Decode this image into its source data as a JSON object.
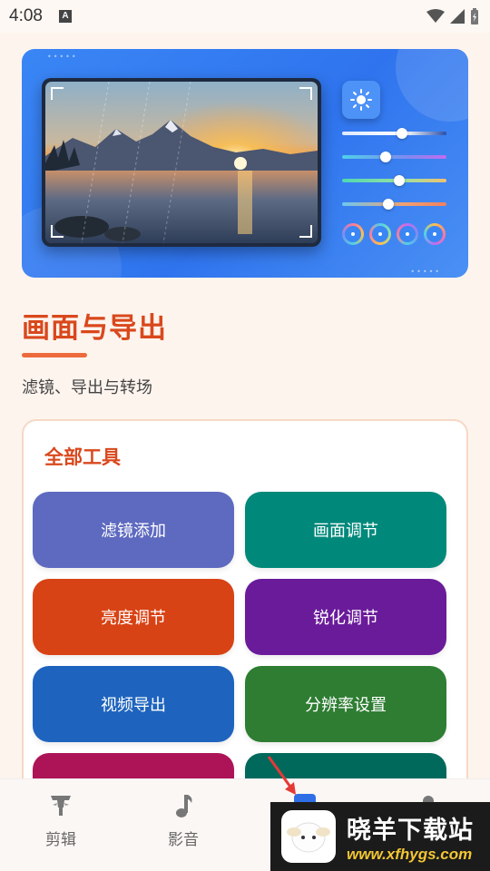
{
  "status_bar": {
    "time": "4:08",
    "notification_icon": "A"
  },
  "hero": {
    "sun_icon": "sun-icon"
  },
  "section": {
    "title": "画面与导出",
    "subtitle": "滤镜、导出与转场"
  },
  "tools": {
    "title": "全部工具",
    "items": [
      {
        "label": "滤镜添加",
        "color": "#5e6ac0"
      },
      {
        "label": "画面调节",
        "color": "#00897b"
      },
      {
        "label": "亮度调节",
        "color": "#d84315"
      },
      {
        "label": "锐化调节",
        "color": "#6a1b9a"
      },
      {
        "label": "视频导出",
        "color": "#1e64be"
      },
      {
        "label": "分辨率设置",
        "color": "#2e7d32"
      },
      {
        "label": "",
        "color": "#ad1457"
      },
      {
        "label": "",
        "color": "#00695c"
      }
    ]
  },
  "bottom_nav": {
    "items": [
      {
        "label": "剪辑",
        "icon": "bulb-tools-icon"
      },
      {
        "label": "影音",
        "icon": "music-note-icon"
      }
    ]
  },
  "watermark": {
    "title": "晓羊下载站",
    "url": "www.xfhygs.com"
  }
}
